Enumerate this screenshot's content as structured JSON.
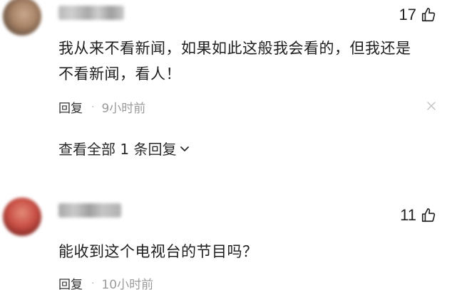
{
  "comments": [
    {
      "likes": "17",
      "content_line1": "我从来不看新闻，如果如此这般我会看的，但我还是",
      "content_line2": "不看新闻，看人！",
      "reply_label": "回复",
      "separator": "·",
      "time": "9小时前",
      "view_all": "查看全部 1 条回复"
    },
    {
      "likes": "11",
      "content_line1": "能收到这个电视台的节目吗？",
      "reply_label": "回复",
      "separator": "·",
      "time": "10小时前"
    }
  ],
  "icons": {
    "like": "thumbs-up-icon",
    "dismiss": "close-icon",
    "expand": "chevron-down-icon"
  }
}
